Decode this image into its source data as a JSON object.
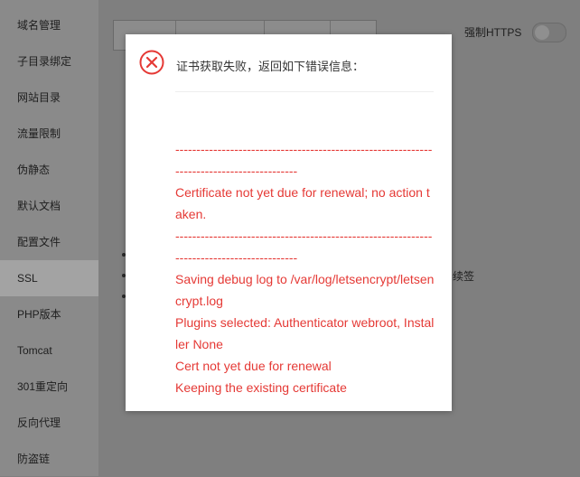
{
  "sidebar": {
    "items": [
      {
        "label": "域名管理"
      },
      {
        "label": "子目录绑定"
      },
      {
        "label": "网站目录"
      },
      {
        "label": "流量限制"
      },
      {
        "label": "伪静态"
      },
      {
        "label": "默认文档"
      },
      {
        "label": "配置文件"
      },
      {
        "label": "SSL"
      },
      {
        "label": "PHP版本"
      },
      {
        "label": "Tomcat"
      },
      {
        "label": "301重定向"
      },
      {
        "label": "反向代理"
      },
      {
        "label": "防盗链"
      }
    ],
    "active": "SSL"
  },
  "main": {
    "https_label": "强制HTTPS",
    "https_enabled": false,
    "bg_fragment": "续签"
  },
  "modal": {
    "icon": "close-circle-icon",
    "title": "证书获取失败，返回如下错误信息：",
    "log_lines": [
      "------------------------------------------------------------------------------------------",
      "Certificate not yet due for renewal; no action taken.",
      "------------------------------------------------------------------------------------------",
      "Saving debug log to /var/log/letsencrypt/letsencrypt.log",
      "Plugins selected: Authenticator webroot, Installer None",
      "Cert not yet due for renewal",
      "Keeping the existing certificate"
    ]
  },
  "colors": {
    "error_red": "#e53935",
    "overlay": "#7f7f7f",
    "modal_bg": "#ffffff"
  }
}
